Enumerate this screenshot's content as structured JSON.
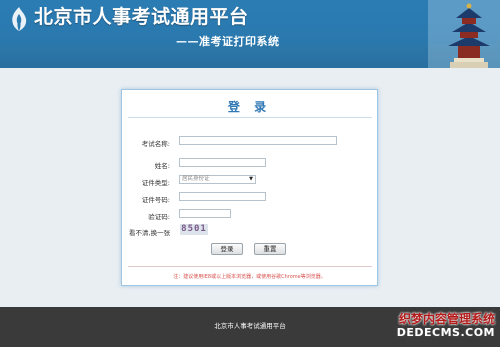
{
  "header": {
    "title": "北京市人事考试通用平台",
    "subtitle": "——准考证打印系统",
    "logo_icon": "flame-logo-icon",
    "decoration_icon": "temple-of-heaven-icon"
  },
  "login": {
    "title": "登 录",
    "fields": {
      "exam_name": {
        "label": "考试名称:",
        "value": ""
      },
      "name": {
        "label": "姓名:",
        "value": ""
      },
      "id_type": {
        "label": "证件类型:",
        "selected": "居民身份证"
      },
      "id_number": {
        "label": "证件号码:",
        "value": ""
      },
      "captcha": {
        "label": "验证码:",
        "value": ""
      }
    },
    "captcha_refresh": "看不清,换一张",
    "captcha_text": "8501",
    "buttons": {
      "login": "登录",
      "reset": "重置"
    },
    "notice": "注：建议使用IE8或以上版本浏览器，或使用谷歌Chrome等浏览器。"
  },
  "footer": {
    "text": "北京市人事考试通用平台"
  },
  "watermark": {
    "line1": "织梦内容管理系统",
    "line2": "DEDECMS.COM"
  },
  "colors": {
    "header_blue": "#2a7ab0",
    "title_blue": "#2f77b5",
    "notice_red": "#d9534f",
    "footer_dark": "#3a3a3a"
  }
}
